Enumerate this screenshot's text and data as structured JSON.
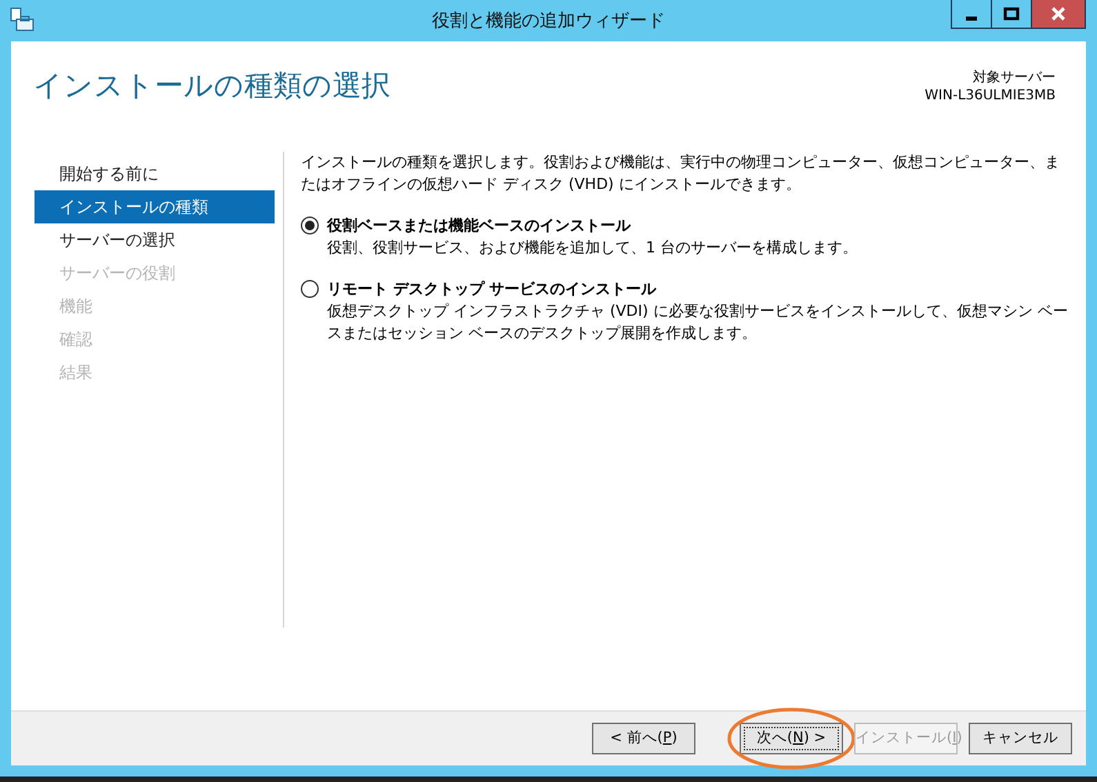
{
  "window": {
    "title": "役割と機能の追加ウィザード",
    "controls": [
      {
        "kind": "minimize"
      },
      {
        "kind": "maximize"
      },
      {
        "kind": "close"
      }
    ]
  },
  "header": {
    "title": "インストールの種類の選択",
    "target_label": "対象サーバー",
    "target_server": "WIN-L36ULMIE3MB"
  },
  "sidebar": {
    "items": [
      {
        "label": "開始する前に",
        "selected": false,
        "disabled": false
      },
      {
        "label": "インストールの種類",
        "selected": true,
        "disabled": false
      },
      {
        "label": "サーバーの選択",
        "selected": false,
        "disabled": false
      },
      {
        "label": "サーバーの役割",
        "selected": false,
        "disabled": true
      },
      {
        "label": "機能",
        "selected": false,
        "disabled": true
      },
      {
        "label": "確認",
        "selected": false,
        "disabled": true
      },
      {
        "label": "結果",
        "selected": false,
        "disabled": true
      }
    ]
  },
  "content": {
    "intro": "インストールの種類を選択します。役割および機能は、実行中の物理コンピューター、仮想コンピューター、またはオフラインの仮想ハード ディスク (VHD) にインストールできます。",
    "options": [
      {
        "label": "役割ベースまたは機能ベースのインストール",
        "description": "役割、役割サービス、および機能を追加して、1 台のサーバーを構成します。",
        "selected": true
      },
      {
        "label": "リモート デスクトップ サービスのインストール",
        "description": "仮想デスクトップ インフラストラクチャ (VDI) に必要な役割サービスをインストールして、仮想マシン ベースまたはセッション ベースのデスクトップ展開を作成します。",
        "selected": false
      }
    ]
  },
  "buttons": [
    {
      "before": "< 前へ(",
      "key": "P",
      "after": ")",
      "disabled": false,
      "highlighted": false
    },
    {
      "before": "次へ(",
      "key": "N",
      "after": ") >",
      "disabled": false,
      "highlighted": true
    },
    {
      "before": "インストール(",
      "key": "I",
      "after": ")",
      "disabled": true,
      "highlighted": false
    },
    {
      "before": "キャンセル",
      "disabled": false,
      "highlighted": false
    }
  ]
}
